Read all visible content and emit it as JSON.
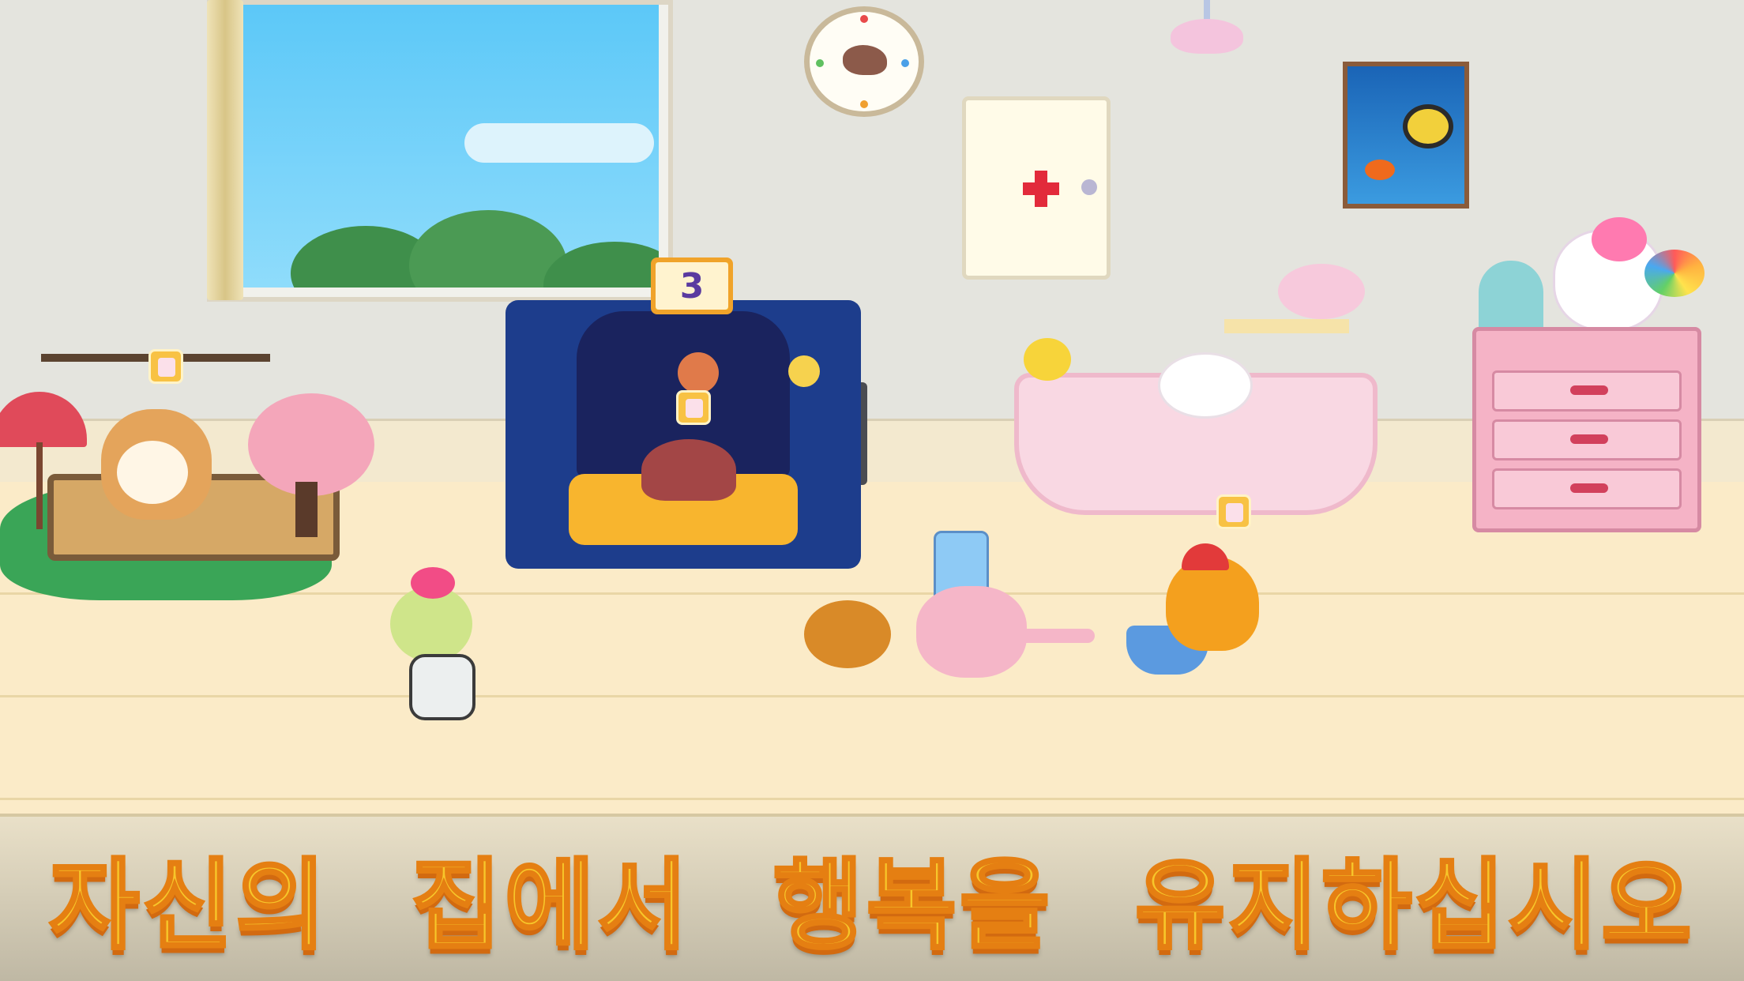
{
  "scene": {
    "room_theme": "pet-house-interior",
    "bedroom_level": "3"
  },
  "caption": {
    "words": [
      "자신의",
      "집에서",
      "행복을",
      "유지하십시오"
    ]
  },
  "colors": {
    "caption_fill": "#f7c62a",
    "caption_outline": "#e57f12",
    "floor": "#fbebc8",
    "wall": "#e4e4de"
  },
  "icons": {
    "need_bubble": "toilet-need-icon",
    "cabinet_mark": "medical-cross-icon"
  }
}
